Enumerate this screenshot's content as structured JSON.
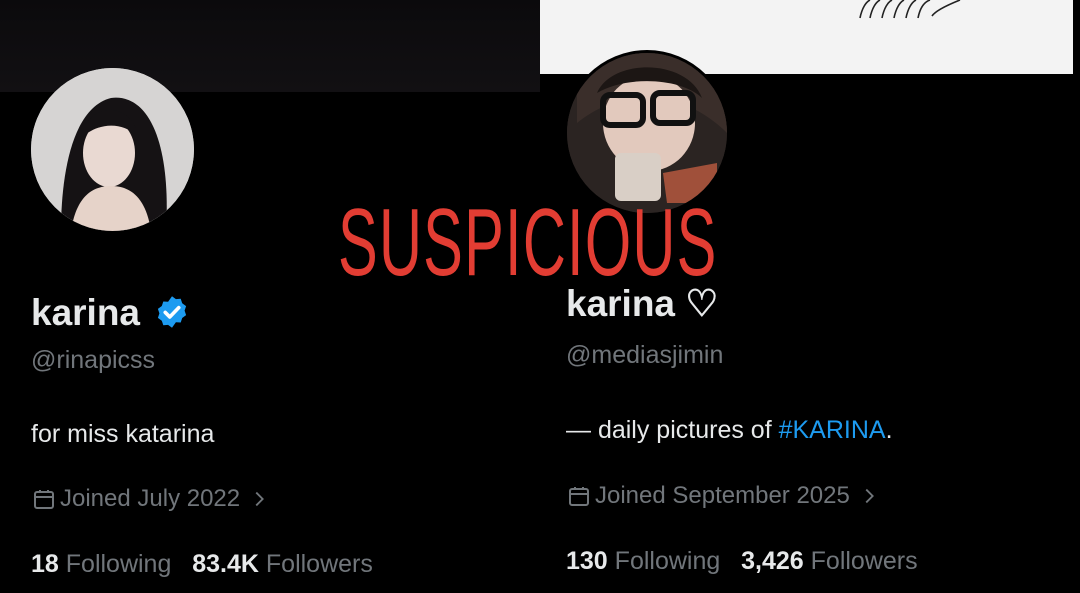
{
  "left_profile": {
    "name": "karina",
    "handle": "@rinapicss",
    "bio": "for miss katarina",
    "joined": "Joined July 2022",
    "following_count": "18",
    "following_label": "Following",
    "followers_count": "83.4K",
    "followers_label": "Followers"
  },
  "right_profile": {
    "name": "karina ♡",
    "handle": "@mediasjimin",
    "bio_prefix": "— daily pictures of ",
    "bio_hashtag": "#KARINA",
    "bio_suffix": ".",
    "joined": "Joined September 2025",
    "following_count": "130",
    "following_label": "Following",
    "followers_count": "3,426",
    "followers_label": "Followers"
  },
  "overlay_text": "SUSPICIOUS",
  "colors": {
    "overlay": "#e23d33",
    "link": "#1d9bf0",
    "verified": "#1d9bf0",
    "muted": "#71767b"
  },
  "icons": [
    "verified-badge-icon",
    "calendar-icon",
    "chevron-right-icon"
  ]
}
